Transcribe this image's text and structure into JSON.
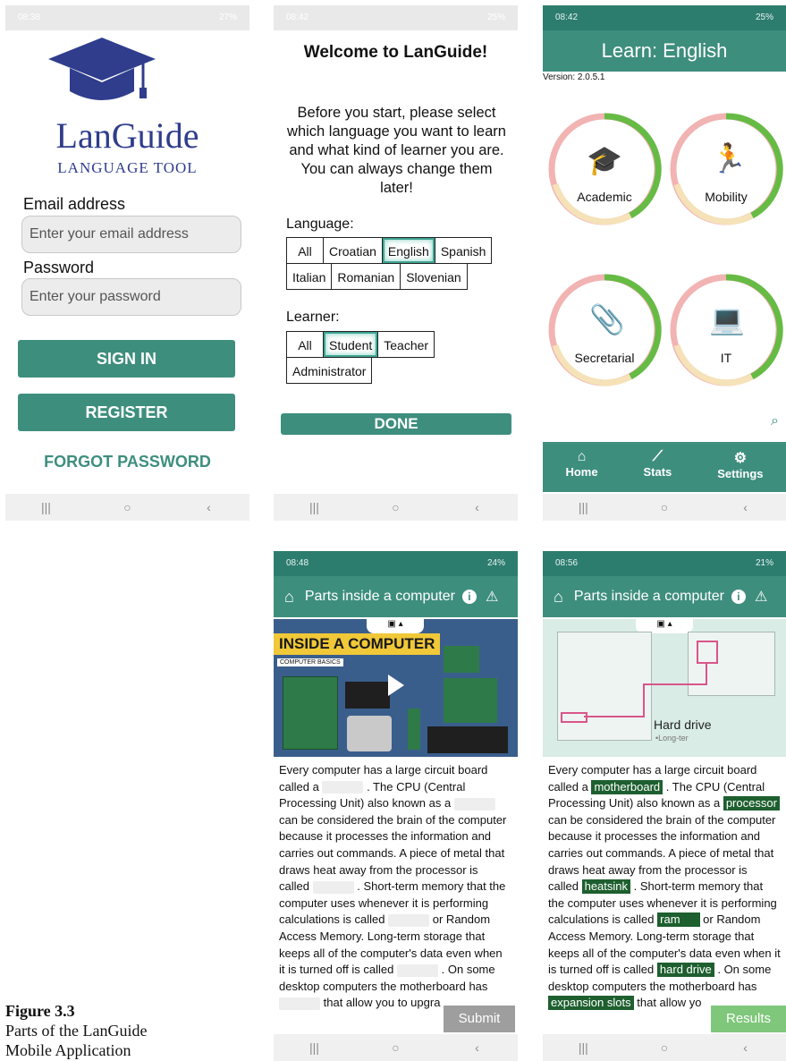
{
  "screen1": {
    "status": {
      "time": "08:38",
      "battery": "27%"
    },
    "logo_title": "LanGuide",
    "logo_subtitle": "LANGUAGE TOOL",
    "email_label": "Email address",
    "email_placeholder": "Enter your email address",
    "password_label": "Password",
    "password_placeholder": "Enter your password",
    "sign_in": "SIGN IN",
    "register": "REGISTER",
    "forgot": "FORGOT PASSWORD",
    "colors": {
      "teal": "#3e8e7e",
      "navy": "#2f3d8c"
    }
  },
  "screen2": {
    "status": {
      "time": "08:42",
      "battery": "25%"
    },
    "title": "Welcome to LanGuide!",
    "intro": "Before you start, please select which language you want to learn and what kind of learner you are. You can always change them later!",
    "language_label": "Language:",
    "languages": [
      "All",
      "Croatian",
      "English",
      "Spanish",
      "Italian",
      "Romanian",
      "Slovenian"
    ],
    "selected_language": "English",
    "learner_label": "Learner:",
    "learners": [
      "All",
      "Student",
      "Teacher",
      "Administrator"
    ],
    "selected_learner": "Student",
    "done": "DONE"
  },
  "screen3": {
    "status": {
      "time": "08:42",
      "battery": "25%"
    },
    "header": "Learn: English",
    "version": "Version: 2.0.5.1",
    "categories": [
      {
        "label": "Academic",
        "icon": "graduation-cap-icon"
      },
      {
        "label": "Mobility",
        "icon": "walking-person-icon"
      },
      {
        "label": "Secretarial",
        "icon": "paperclip-document-icon"
      },
      {
        "label": "IT",
        "icon": "laptop-phone-icon"
      }
    ],
    "nav": [
      {
        "label": "Home",
        "icon": "home-icon"
      },
      {
        "label": "Stats",
        "icon": "stats-icon"
      },
      {
        "label": "Settings",
        "icon": "gear-icon"
      }
    ],
    "colors": {
      "ring_green": "#66bb44",
      "ring_red": "#f2b3b3",
      "ring_yellow": "#f5e2b8",
      "header": "#3e8e7e"
    }
  },
  "screen4": {
    "status": {
      "time": "08:48",
      "battery": "24%"
    },
    "title": "Parts inside a computer",
    "video_banner": "INSIDE A COMPUTER",
    "video_sub": "COMPUTER BASICS",
    "text_parts": [
      "Every computer has a large circuit board called a",
      ". The CPU (Central Processing Unit) also known as a",
      "can be considered the brain of the computer because it processes the information and carries out commands. A piece of metal that draws heat away from the processor is called",
      ". Short-term memory that the computer uses whenever it is performing calculations is called",
      "or Random Access Memory. Long-term storage that keeps all of the computer's data even when it is turned off is called",
      ". On some desktop computers the motherboard has",
      "that allow you to upgra"
    ],
    "submit": "Submit"
  },
  "screen5": {
    "status": {
      "time": "08:56",
      "battery": "21%"
    },
    "title": "Parts inside a computer",
    "diagram_label": "Hard drive",
    "diagram_sublabel": "•Long-ter",
    "answers": [
      "motherboard",
      "processor",
      "heatsink",
      "ram",
      "hard drive",
      "expansion slots"
    ],
    "text_tail": "that allow yo",
    "results": "Results"
  },
  "caption": {
    "figure": "Figure  3.3",
    "line1": "Parts of the LanGuide",
    "line2": "Mobile Application"
  }
}
